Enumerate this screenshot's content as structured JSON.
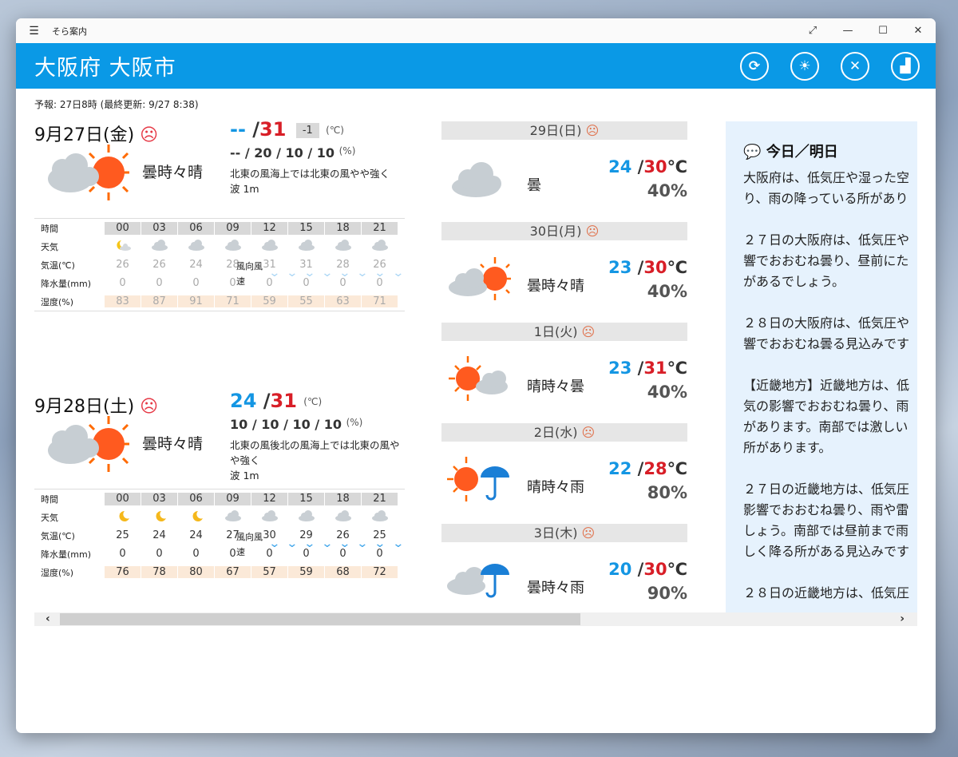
{
  "window": {
    "title": "そら案内"
  },
  "titlebar": {
    "menu_icon": "☰",
    "expand": "⤢",
    "minimize": "—",
    "maximize": "☐",
    "close": "✕"
  },
  "header": {
    "city": "大阪府 大阪市",
    "buttons": [
      "refresh-icon",
      "sun-cloud-icon",
      "satellite-icon",
      "chart-icon"
    ]
  },
  "forecast_time": "予報: 27日8時 (最終更新: 9/27 8:38)",
  "day1": {
    "title": "9月27日(金)",
    "face": "☹",
    "weather": "曇時々晴",
    "temp_low": "--",
    "temp_high": "31",
    "slash": "/",
    "diff": "-1",
    "temp_unit": "(℃)",
    "precip": "-- / 20 / 10 / 10",
    "precip_unit": "(%)",
    "wind": "北東の風海上では北東の風やや強く",
    "wave": "波 1m",
    "table": {
      "labels": [
        "時間",
        "天気",
        "気温(℃)",
        "降水量(mm)",
        "湿度(%)",
        "風向風速"
      ],
      "hours": [
        "00",
        "03",
        "06",
        "09",
        "12",
        "15",
        "18",
        "21"
      ],
      "weather": [
        "moon-cloud",
        "cloud",
        "cloud",
        "cloud",
        "cloud",
        "cloud",
        "cloud",
        "cloud"
      ],
      "temps": [
        "26",
        "26",
        "24",
        "28",
        "31",
        "31",
        "28",
        "26"
      ],
      "rain": [
        "0",
        "0",
        "0",
        "0",
        "0",
        "0",
        "0",
        "0"
      ],
      "humidity": [
        "83",
        "87",
        "91",
        "71",
        "59",
        "55",
        "63",
        "71"
      ]
    }
  },
  "day2": {
    "title": "9月28日(土)",
    "face": "☹",
    "weather": "曇時々晴",
    "temp_low": "24",
    "temp_high": "31",
    "slash": "/",
    "temp_unit": "(℃)",
    "precip": "10 / 10 / 10 / 10",
    "precip_unit": "(%)",
    "wind": "北東の風後北の風海上では北東の風やや強く",
    "wave": "波 1m",
    "table": {
      "labels": [
        "時間",
        "天気",
        "気温(℃)",
        "降水量(mm)",
        "湿度(%)",
        "風向風速"
      ],
      "hours": [
        "00",
        "03",
        "06",
        "09",
        "12",
        "15",
        "18",
        "21"
      ],
      "weather": [
        "moon-star",
        "moon-star",
        "moon-star",
        "cloud",
        "cloud",
        "cloud",
        "cloud",
        "cloud"
      ],
      "temps": [
        "25",
        "24",
        "24",
        "27",
        "30",
        "29",
        "26",
        "25"
      ],
      "rain": [
        "0",
        "0",
        "0",
        "0",
        "0",
        "0",
        "0",
        "0"
      ],
      "humidity": [
        "76",
        "78",
        "80",
        "67",
        "57",
        "59",
        "68",
        "72"
      ]
    }
  },
  "weekly": [
    {
      "date": "29日(日)",
      "face": "☹",
      "weather": "曇",
      "low": "24",
      "high": "30",
      "unit": "℃",
      "pop": "40%",
      "icon": "cloud"
    },
    {
      "date": "30日(月)",
      "face": "☹",
      "weather": "曇時々晴",
      "low": "23",
      "high": "30",
      "unit": "℃",
      "pop": "40%",
      "icon": "cloud-sun"
    },
    {
      "date": "1日(火)",
      "face": "☹",
      "weather": "晴時々曇",
      "low": "23",
      "high": "31",
      "unit": "℃",
      "pop": "40%",
      "icon": "sun-cloud"
    },
    {
      "date": "2日(水)",
      "face": "☹",
      "weather": "晴時々雨",
      "low": "22",
      "high": "28",
      "unit": "℃",
      "pop": "80%",
      "icon": "sun-umbrella"
    },
    {
      "date": "3日(木)",
      "face": "☹",
      "weather": "曇時々雨",
      "low": "20",
      "high": "30",
      "unit": "℃",
      "pop": "90%",
      "icon": "cloud-umbrella"
    }
  ],
  "summary": {
    "heading": "今日／明日",
    "text": "大阪府は、低気圧や湿った空\nり、雨の降っている所があり\n\n２７日の大阪府は、低気圧や\n響でおおむね曇り、昼前にた\nがあるでしょう。\n\n２８日の大阪府は、低気圧や\n響でおおむね曇る見込みです\n\n【近畿地方】近畿地方は、低\n気の影響でおおむね曇り、雨\nがあります。南部では激しい\n所があります。\n\n２７日の近畿地方は、低気圧\n影響でおおむね曇り、雨や雷\nしょう。南部では昼前まで雨\nしく降る所がある見込みです\n\n２８日の近畿地方は、低気圧"
  },
  "scrollbar": {
    "left": "‹",
    "right": "›"
  }
}
